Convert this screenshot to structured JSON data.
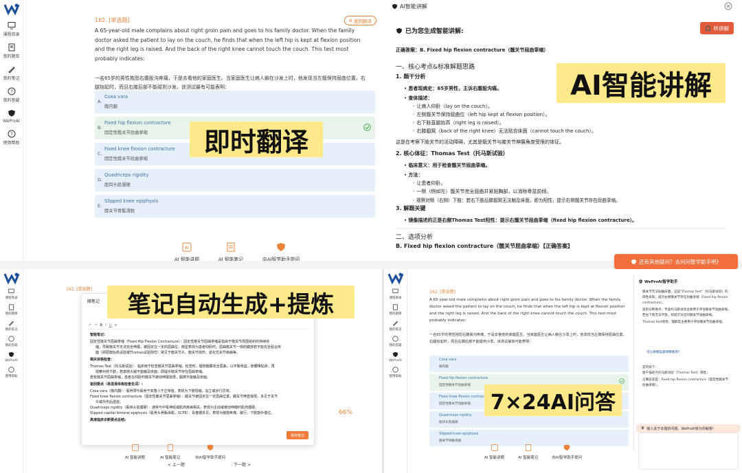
{
  "nav": {
    "items": [
      "课程目录",
      "我的题库",
      "我的笔记",
      "我的答疑",
      "WeProAI",
      "使用帮助"
    ]
  },
  "question": {
    "number": "162. [单选题]",
    "translate_label": "查回翻译",
    "stem_en": "A 65-year-old male complains about right groin pain and goes to his family doctor. When the family doctor asked the patient to lay on the couch, he finds that when the left hip is kept at flexion position and the right leg is raised. And the back of the right knee cannot touch the couch. This test most probably indicates:",
    "stem_zh": "一名65岁的男性抱怨右腹股沟疼痛，于是去看他的家庭医生。当家庭医生让病人躺在沙发上时，他发现当左髋保持屈曲位置，右腿抬起时，而且右膝后部不能碰到沙发。该测试最有可能表明：",
    "options": [
      {
        "letter": "A.",
        "en": "Coxa vara",
        "zh": "髋内翻"
      },
      {
        "letter": "B.",
        "en": "Fixed hip flexion contracture",
        "zh": "固定性髋关节屈曲挛缩"
      },
      {
        "letter": "C.",
        "en": "Fixed knee flexion contracture",
        "zh": "固定性膝关节屈曲挛缩"
      },
      {
        "letter": "D.",
        "en": "Quadriceps rigidity",
        "zh": "股四头肌僵硬"
      },
      {
        "letter": "E.",
        "en": "Slipped knee epiphysis",
        "zh": "膝关节骨骺滑脱"
      }
    ]
  },
  "tools": {
    "ai_explain": "AI 智能讲题",
    "ai_notes": "AI 智能笔记",
    "ask_ai": "向AI智学助手提问"
  },
  "banners": {
    "translate": "即时翻译",
    "explain": "AI智能讲解",
    "notes": "笔记自动生成+提炼",
    "qa": "7×24AI问答"
  },
  "explain_panel": {
    "title": "AI智能讲解",
    "listen": "听讲解",
    "generated": "已为您生成智能讲解:",
    "answer_line": "正确答案：B. Fixed hip flexion contracture（髋关节屈曲挛缩）",
    "sec1": "一、核心考点&标准解题思路",
    "sub1": "1. 题干分析",
    "l1": "患者现病史：65岁男性，主诉右腹股沟痛。",
    "l2": "查体描述：",
    "l3": "让病人仰卧（lay on the couch）。",
    "l4": "左侧髋关节保持屈曲位（left hip kept at flexion position）。",
    "l5": "右下肢直腿抬高（right leg is raised）。",
    "l6": "右膝腘窝（back of the right knee）无法贴合床面（cannot touch the couch）。",
    "l7": "这是在考察下肢关节的活动障碍，尤其是髋关节与膝关节伸展角度受限的体征。",
    "sub2": "2. 核心体征：Thomas Test（托马斯试验）",
    "l8": "临床意义：用于检查髋关节屈曲挛缩。",
    "l9": "方法：",
    "l10": "让患者仰卧。",
    "l11": "一侧（例如左）髋关节完全屈曲并紧贴胸部，以消除骨盆前倾。",
    "l12": "观察对侧（右侧）下肢：若右下肢后膝腘窝无法触及床面，即为阳性，提示右侧髋关节存在屈曲挛缩。",
    "sub3": "3. 解题关键",
    "l13": "镜像描述的正是右侧Thomas Test阳性：提示右髋关节屈曲挛缩（fixed hip flexion contracture）。",
    "sec2": "二、选项分析",
    "l14": "B. Fixed hip flexion contracture（髋关节屈曲挛缩）【正确答案】",
    "ask_more": "还有其他疑问？去问问智学助手吧》"
  },
  "notes_panel": {
    "title": "随笔记",
    "lines": [
      "智能笔记:",
      "固定性髋关节屈曲挛缩（Fixed Hip Flexion Contracture）：固定性髋关节屈曲挛缩是指由于髋关节周围组织的持续收",
      "缩，导致髋关节无法完全伸展，被固定在一定的屈曲位。典型表现为患者仰卧时，屈曲髋关节一侧的膝部若不能完全贴合床",
      "面（即屈髋抬高试验或Thomas试验阳性）常见于髋关节炎、髋关节损伤、退化性关节疾病等。",
      "相关体格检查:",
      "Thomas Test（托马斯试验）：临床用于检查髋关节屈曲挛缩。检查时，健侧髋膝完全屈曲，以平衡骨盆，使腰椎贴床，再",
      "观察对侧下肢，若患侧大腿不能触及床面，即提示髋关节存在屈曲挛缩。",
      "若有髋关节屈曲挛缩，患者在仰卧时髋关节被动伸展受限，腘窝不能触及床面。",
      "鉴别要点（易混淆体格检查名词）:",
      "Coxa vara（髋内翻）：股骨颈与股骨干夹角小于正常值，表现为下肢短缩，站立或步行异常。",
      "Fixed knee flexion contracture（固定性膝关节屈曲挛缩）：膝关节被固定在一定屈曲位置，膝关节伸直受限，多见于关节",
      "炎或外伤后遗症。",
      "Quadriceps rigidity（股四头肌僵硬）：通常与中枢神经或肌肉疾病相关，表现为主动或被动伸膝时肌肉僵硬。",
      "Slipped capital femoral epiphysis（股骨头骨骺滑脱，SCFE）：青春期多见，表现为髋部疼痛、跛行，下肢旋外僵位。",
      "高液临床诊断要点总结:"
    ],
    "save": "保存笔记",
    "prev": "< 上一题",
    "next": "下一题 >",
    "percent": "66%"
  },
  "chat_panel": {
    "title": "WeProAI智学助手",
    "placeholder": "输入关于本题的问题，WeProAI将为你解答!",
    "lines": [
      "膝关节无法贴触床面，这是\"Thomas test\"（托马斯试验）的",
      "阳性表现，提示右侧髋关节存在屈曲挛缩（Fixed hip flexion",
      "contracture）。",
      "鉴别诊断要点：专查托马斯试验主要用于评估髋关节屈曲挛缩，",
      "若右下肢无法平放，则提示对应的髋关节屈曲挛缩。",
      "Thomas test阳性：理解其主要用于评估髋关节屈曲挛缩。",
      "可以将哪些题目都看完?",
      "是的如下：",
      "题干描述为托马斯试验（Thomas Test）阳性。",
      "正确答案是：Fixed hip flexion contracture（固定性髋关节",
      "屈曲挛缩）。"
    ]
  }
}
